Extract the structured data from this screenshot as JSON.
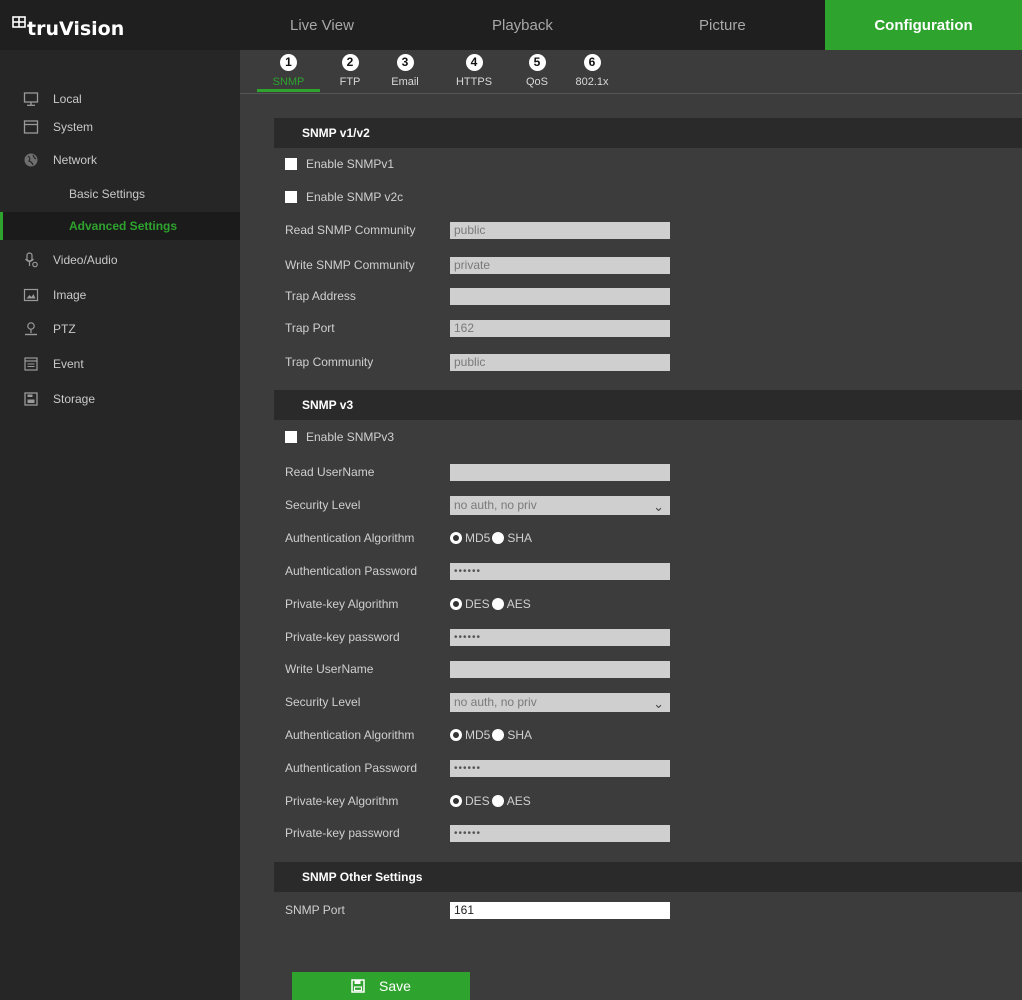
{
  "brand": {
    "name": "truVision"
  },
  "topnav": {
    "tabs": [
      "Live View",
      "Playback",
      "Picture",
      "Configuration"
    ],
    "active": "Configuration"
  },
  "sidebar": {
    "items": [
      {
        "label": "Local",
        "icon": "monitor-icon"
      },
      {
        "label": "System",
        "icon": "system-window-icon"
      },
      {
        "label": "Network",
        "icon": "globe-icon"
      },
      {
        "label": "Basic Settings",
        "sub": true
      },
      {
        "label": "Advanced Settings",
        "sub": true,
        "active": true
      },
      {
        "label": "Video/Audio",
        "icon": "microphone-icon"
      },
      {
        "label": "Image",
        "icon": "image-icon"
      },
      {
        "label": "PTZ",
        "icon": "ptz-camera-icon"
      },
      {
        "label": "Event",
        "icon": "calendar-icon"
      },
      {
        "label": "Storage",
        "icon": "storage-icon"
      }
    ]
  },
  "subtabs": [
    {
      "num": "1",
      "label": "SNMP",
      "active": true
    },
    {
      "num": "2",
      "label": "FTP"
    },
    {
      "num": "3",
      "label": "Email"
    },
    {
      "num": "4",
      "label": "HTTPS"
    },
    {
      "num": "5",
      "label": "QoS"
    },
    {
      "num": "6",
      "label": "802.1x"
    }
  ],
  "snmp_v1v2": {
    "header": "SNMP v1/v2",
    "enable_v1": "Enable SNMPv1",
    "enable_v2c": "Enable SNMP v2c",
    "read_community_label": "Read SNMP Community",
    "read_community": "public",
    "write_community_label": "Write SNMP Community",
    "write_community": "private",
    "trap_address_label": "Trap Address",
    "trap_address": "",
    "trap_port_label": "Trap Port",
    "trap_port": "162",
    "trap_community_label": "Trap Community",
    "trap_community": "public"
  },
  "snmp_v3": {
    "header": "SNMP v3",
    "enable_v3": "Enable SNMPv3",
    "read_username_label": "Read UserName",
    "read_username": "",
    "security_level_label": "Security Level",
    "read_security_level": "no auth, no priv",
    "auth_algo_label": "Authentication Algorithm",
    "auth_options": [
      "MD5",
      "SHA"
    ],
    "auth_password_label": "Authentication Password",
    "read_auth_password": "••••••",
    "priv_algo_label": "Private-key Algorithm",
    "priv_options": [
      "DES",
      "AES"
    ],
    "priv_password_label": "Private-key password",
    "read_priv_password": "••••••",
    "write_username_label": "Write UserName",
    "write_username": "",
    "write_security_level": "no auth, no priv",
    "write_auth_password": "••••••",
    "write_priv_password": "••••••"
  },
  "other": {
    "header": "SNMP Other Settings",
    "port_label": "SNMP Port",
    "port": "161"
  },
  "save_label": "Save",
  "colors": {
    "accent": "#2ea32e",
    "panel": "#3c3c3c",
    "sidebar": "#262626",
    "topbar": "#1f1f1f"
  }
}
